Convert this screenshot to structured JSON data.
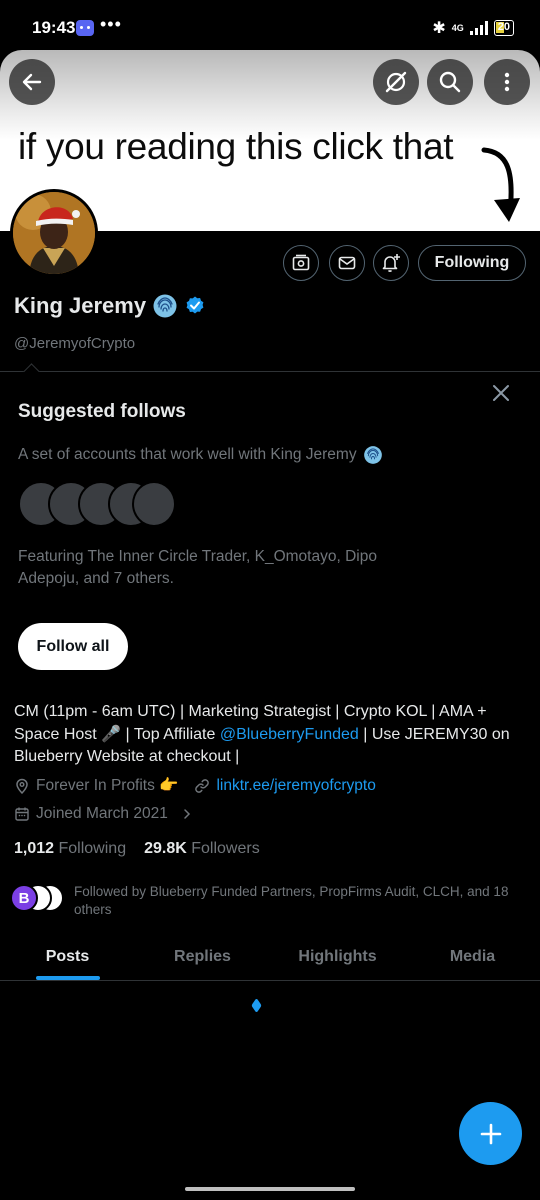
{
  "status_bar": {
    "time": "19:43",
    "dots": "•••",
    "network": "4G",
    "battery": "20"
  },
  "banner": {
    "text": "if you reading this click that"
  },
  "profile": {
    "display_name": "King Jeremy",
    "handle": "@JeremyofCrypto",
    "following_label": "Following",
    "verified_color": "#1d9bf0"
  },
  "suggested": {
    "title": "Suggested follows",
    "description": "A set of accounts that work well with King Jeremy",
    "featuring": "Featuring The Inner Circle Trader, K_Omotayo, Dipo Adepoju, and 7 others.",
    "follow_all_label": "Follow all"
  },
  "bio": {
    "part1": "CM (11pm - 6am UTC) | Marketing Strategist | Crypto KOL | AMA + Space Host 🎤 | Top Affiliate ",
    "mention": "@BlueberryFunded",
    "part2": " | Use JEREMY30 on Blueberry Website at checkout |"
  },
  "meta": {
    "location": "Forever In Profits 👉",
    "website": "linktr.ee/jeremyofcrypto",
    "joined": "Joined March 2021"
  },
  "stats": {
    "following_count": "1,012",
    "following_label": "Following",
    "followers_count": "29.8K",
    "followers_label": "Followers"
  },
  "followed_by": {
    "avatar_letter": "B",
    "text": "Followed by Blueberry Funded Partners, PropFirms Audit, CLCH, and 18 others"
  },
  "tabs": [
    {
      "label": "Posts",
      "active": true
    },
    {
      "label": "Replies",
      "active": false
    },
    {
      "label": "Highlights",
      "active": false
    },
    {
      "label": "Media",
      "active": false
    }
  ],
  "colors": {
    "accent": "#1d9bf0",
    "background": "#000000",
    "secondary_text": "#71767b"
  }
}
